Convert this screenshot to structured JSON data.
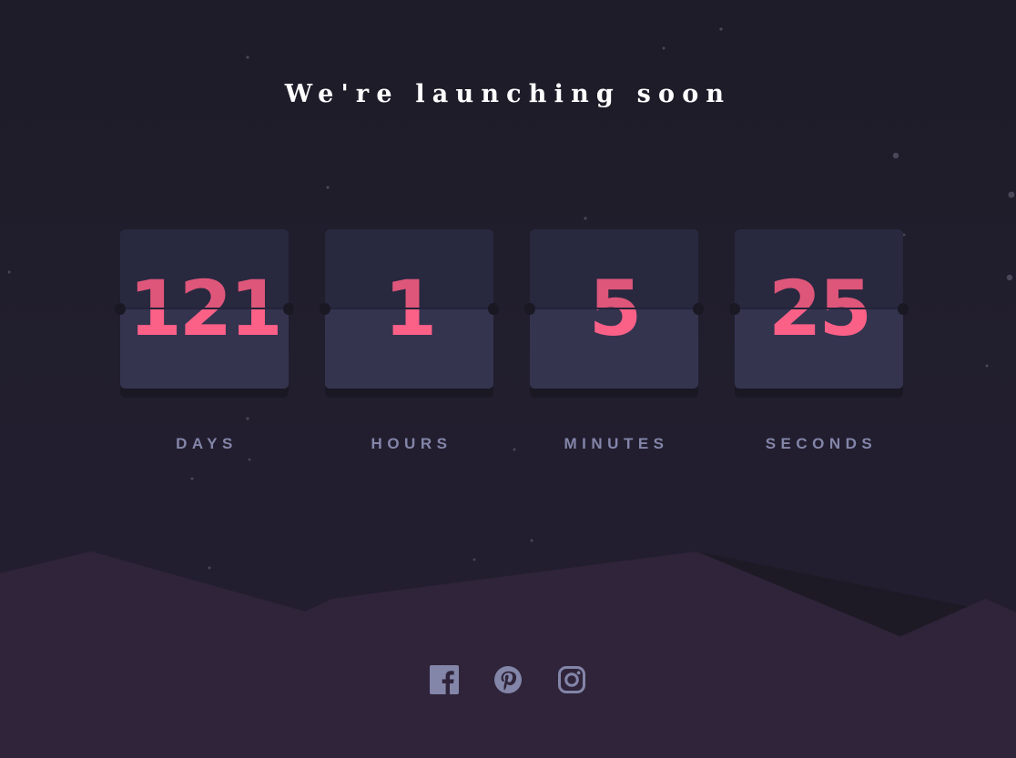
{
  "page": {
    "title": "We're launching soon"
  },
  "countdown": [
    {
      "value": "121",
      "unit": "DAYS"
    },
    {
      "value": "1",
      "unit": "HOURS"
    },
    {
      "value": "5",
      "unit": "MINUTES"
    },
    {
      "value": "25",
      "unit": "SECONDS"
    }
  ],
  "social": [
    {
      "icon": "facebook-icon"
    },
    {
      "icon": "pinterest-icon"
    },
    {
      "icon": "instagram-icon"
    }
  ],
  "colors": {
    "background": "#1f1d2b",
    "card": "#34344f",
    "number": "#fb6087",
    "label": "#8385a9",
    "hills": "#2f2439",
    "icon": "#8385a9"
  }
}
